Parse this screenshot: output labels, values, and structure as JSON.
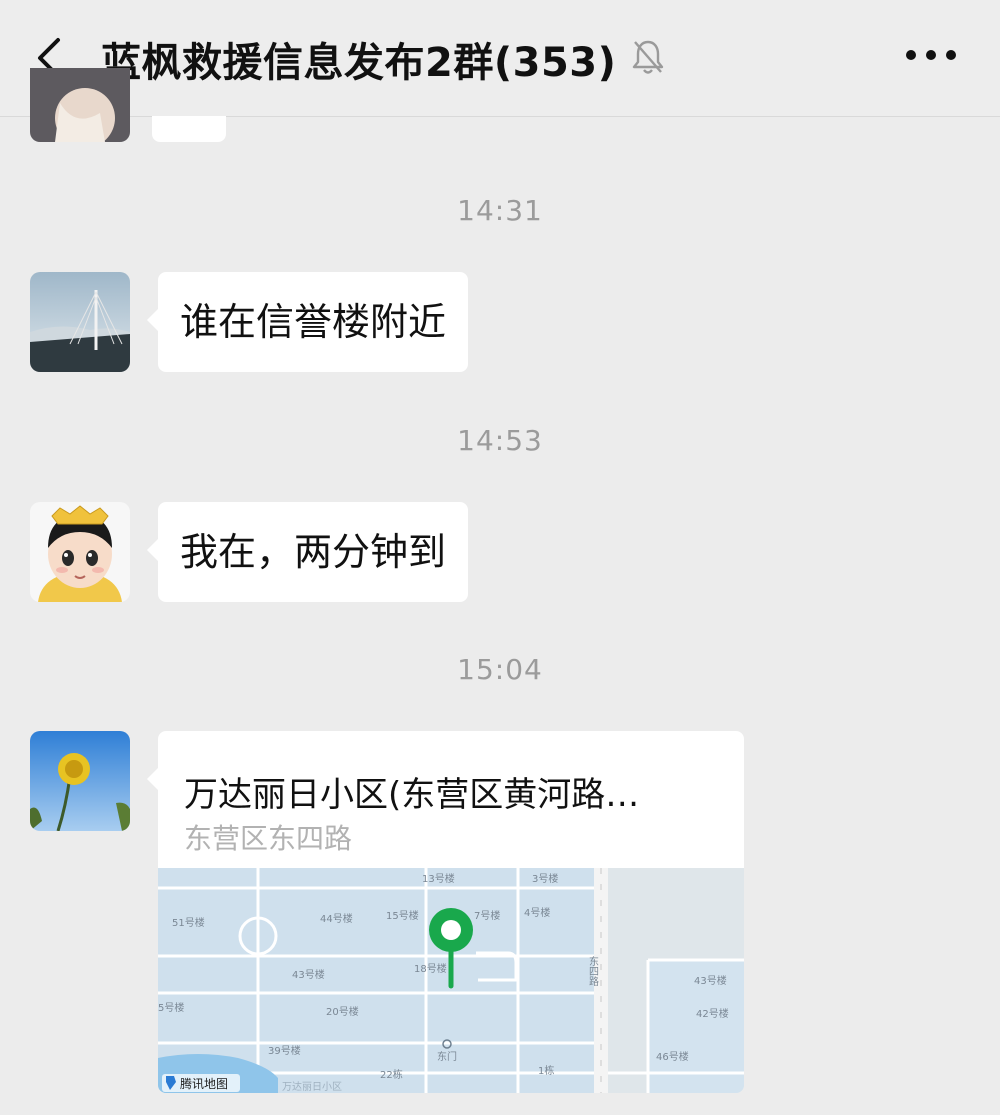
{
  "header": {
    "title": "蓝枫救援信息发布2群(353)",
    "back_icon": "chevron-left-icon",
    "mute_icon": "bell-muted-icon",
    "more_icon": "more-dots-icon"
  },
  "messages": [
    {
      "time": "14:31",
      "text": "谁在信誉楼附近"
    },
    {
      "time": "14:53",
      "text": "我在，两分钟到"
    },
    {
      "time": "15:04",
      "location": {
        "name": "万达丽日小区(东营区黄河路…",
        "address": "东营区东四路",
        "map_labels": {
          "b13": "13号楼",
          "b3": "3号楼",
          "b51": "51号楼",
          "b44": "44号楼",
          "b15": "15号楼",
          "b7": "7号楼",
          "b4": "4号楼",
          "b43a": "43号楼",
          "b18": "18号楼",
          "b5": "5号楼",
          "b20": "20号楼",
          "b39": "39号楼",
          "b22": "22栋",
          "b1": "1栋",
          "gate": "东门",
          "road": "东四路",
          "b43b": "43号楼",
          "b42": "42号楼",
          "b46": "46号楼",
          "bottom": "万达丽日小区",
          "brand": "腾讯地图"
        }
      }
    }
  ]
}
